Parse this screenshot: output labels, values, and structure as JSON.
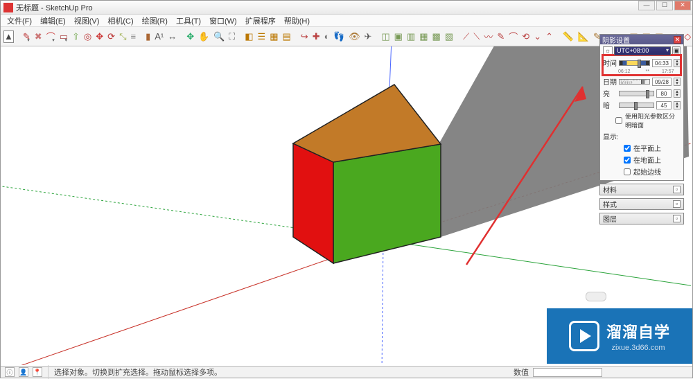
{
  "title": "无标题 - SketchUp Pro",
  "menus": [
    "文件(F)",
    "编辑(E)",
    "视图(V)",
    "相机(C)",
    "绘图(R)",
    "工具(T)",
    "窗口(W)",
    "扩展程序",
    "帮助(H)"
  ],
  "statusbar": {
    "hint": "选择对象。切换到扩充选择。拖动鼠标选择多项。",
    "right_label": "数值"
  },
  "shadow_panel": {
    "title": "阴影设置",
    "timezone_label": "UTC+08:00",
    "time_label": "时间",
    "time_min": "06:12",
    "time_max": "17:57",
    "time_value": "04:33",
    "date_label": "日期",
    "date_ticks": "1 2 3 4 5 6 7 8 9 101112",
    "date_value": "09/28",
    "light_label": "亮",
    "light_value": "80",
    "dark_label": "暗",
    "dark_value": "45",
    "use_sun_label": "使用阳光参数区分明暗面",
    "display_label": "显示:",
    "display_opts": [
      "在平面上",
      "在地面上",
      "起始边线"
    ],
    "display_checked": [
      true,
      true,
      false
    ]
  },
  "collapsed_panels": [
    "材料",
    "样式",
    "图层"
  ],
  "watermark": {
    "main": "溜溜自学",
    "sub": "zixue.3d66.com"
  }
}
